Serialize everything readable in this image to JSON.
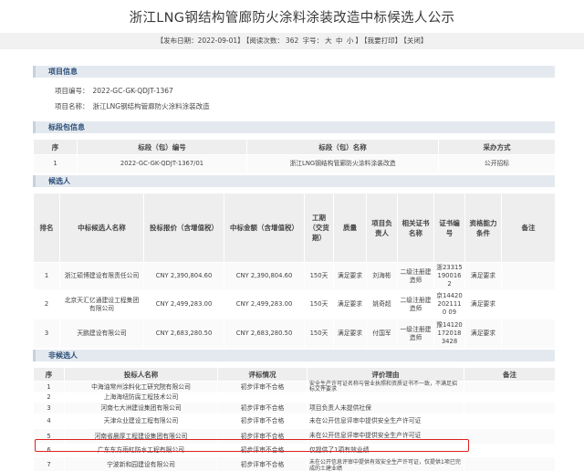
{
  "title": "浙江LNG钢结构管廊防火涂料涂装改造中标候选人公示",
  "meta": {
    "publish_label": "【发布日期：2022-09-01】",
    "views_label": "【阅读次数：",
    "views_count": "362",
    "fontsize_label": "字号：",
    "size_large": "大",
    "size_medium": "中",
    "size_small": "小",
    "views_close": "】",
    "collect": "【我要打印】",
    "close": "【关闭】"
  },
  "project": {
    "heading": "项目信息",
    "code_label": "项目编号：",
    "code": "2022-GC-GK-QDJT-1367",
    "name_label": "项目名称：",
    "name": "浙江LNG钢结构管廊防火涂料涂装改造"
  },
  "lot": {
    "heading": "标段包信息",
    "headers": [
      "序",
      "标段（包）编号",
      "标段（包）名称",
      "采办方式"
    ],
    "rows": [
      [
        "1",
        "2022-GC-GK-QDJT-1367/01",
        "浙江LNG钢结构管廊防火涂料涂装改造",
        "公开招标"
      ]
    ]
  },
  "candidates": {
    "heading": "候选人",
    "headers": [
      "排名",
      "中标候选人名称",
      "投标报价（含增值税）",
      "中标金额（含增值税）",
      "工期（交货期）",
      "质量",
      "项目负责人",
      "相关证书名称",
      "证书编号",
      "资格能力条件",
      "备注"
    ],
    "rows": [
      [
        "1",
        "浙江硕博建设有限责任公司",
        "CNY 2,390,804.60",
        "CNY 2,390,804.60",
        "150天",
        "满足要求",
        "刘海彬",
        "二级注册建造师",
        "浙233151900162",
        "满足要求",
        ""
      ],
      [
        "2",
        "北京天汇亿通建设工程集团有限公司",
        "CNY 2,499,283.00",
        "CNY 2,499,283.00",
        "150天",
        "满足要求",
        "姚奇超",
        "二级注册建造师",
        "京144202021110 09",
        "满足要求",
        ""
      ],
      [
        "3",
        "天鹏建设有限公司",
        "CNY 2,683,280.50",
        "CNY 2,683,280.50",
        "150天",
        "满足要求",
        "付国军",
        "一级注册建造师",
        "豫141201720183428",
        "满足要求",
        ""
      ]
    ]
  },
  "non_candidates": {
    "heading": "非候选人",
    "headers": [
      "序",
      "投标人名称",
      "评标情况",
      "评价理由",
      "备注"
    ],
    "rows": [
      [
        "1",
        "中海油常州涂料化工研究院有限公司",
        "初步评审不合格",
        "安全生产许可证名称与营业执照和资质证书不一致，不满足招标文件要求",
        ""
      ],
      [
        "2",
        "上海海纽防腐工程技术公司",
        "",
        "",
        ""
      ],
      [
        "3",
        "河南七大洲建设集团有限公司",
        "初步评审不合格",
        "项目负责人未提供社保",
        ""
      ],
      [
        "4",
        "天津众业建设工程有限公司",
        "初步评审不合格",
        "未在公开信息评审中提供安全生产许可证",
        ""
      ],
      [
        "5",
        "河南省晨厚工程建设集团有限公司",
        "初步评审不合格",
        "未在公开信息评审中提供安全生产许可证",
        ""
      ],
      [
        "6",
        "广东东方雨虹防水工程有限公司",
        "初步评审不合格",
        "仅提供了1项有效业绩",
        ""
      ],
      [
        "7",
        "宁波新和园建设有限公司",
        "初步评审不合格",
        "未在公开信息评审中提供有效安全生产许可证，仅提供1项已完成的土建业绩",
        ""
      ]
    ]
  }
}
